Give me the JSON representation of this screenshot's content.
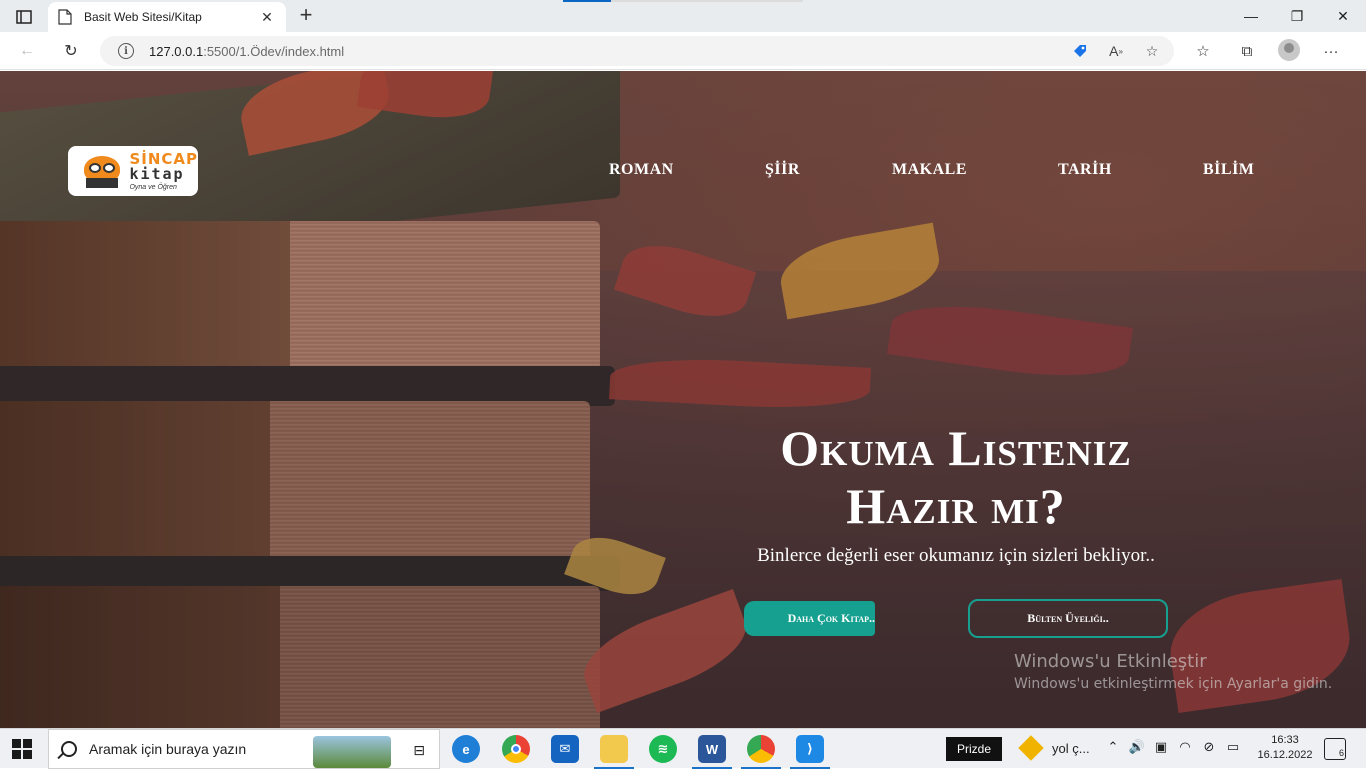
{
  "browser": {
    "tab_title": "Basit Web Sitesi/Kitap",
    "url_host": "127.0.0.1",
    "url_rest": ":5500/1.Ödev/index.html",
    "tab_close": "✕",
    "new_tab": "+",
    "window_controls": [
      "—",
      "❐",
      "✕"
    ],
    "nav": {
      "back": "←",
      "refresh": "↻"
    },
    "url_icons": [
      "tag-icon",
      "read-aloud-icon",
      "favorite-add-icon"
    ],
    "right_icons": [
      "favorites-icon",
      "collections-icon",
      "profile-icon",
      "more-icon"
    ]
  },
  "site": {
    "logo": {
      "line1": "SİNCAP",
      "line2": "kitap",
      "line3": "Oyna ve Öğren"
    },
    "nav": [
      "ROMAN",
      "ŞİİR",
      "MAKALE",
      "TARİH",
      "BİLİM"
    ],
    "hero": {
      "title_line1": "Okuma Listeniz",
      "title_line2": "Hazır mı?",
      "subtitle": "Binlerce değerli eser okumanız için sizleri bekliyor..",
      "primary_button": "Daha Çok Kitap..",
      "secondary_button": "Bülten Üyeliği.."
    },
    "colors": {
      "accent": "#16a090",
      "logo_orange": "#f08a1c"
    }
  },
  "watermark": {
    "line1": "Windows'u Etkinleştir",
    "line2": "Windows'u etkinleştirmek için Ayarlar'a gidin."
  },
  "taskbar": {
    "search_placeholder": "Aramak için buraya yazın",
    "apps": [
      "edge-icon",
      "chrome-icon",
      "mail-icon",
      "file-explorer-icon",
      "spotify-icon",
      "word-icon",
      "chrome-profile-icon",
      "vscode-icon"
    ],
    "tray_label": "Prizde",
    "weather_text": "yol ç...",
    "time": "16:33",
    "date": "16.12.2022",
    "notification_count": "6"
  }
}
